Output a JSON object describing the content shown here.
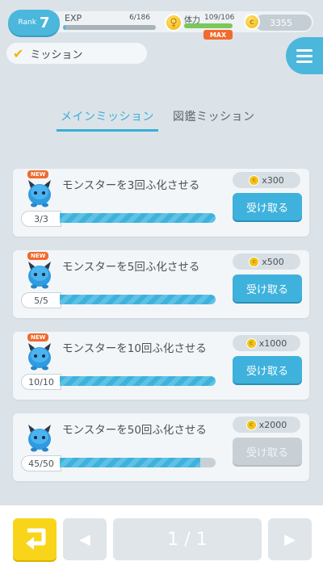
{
  "header": {
    "rank_label": "Rank",
    "rank_value": "7",
    "exp_label": "EXP",
    "exp_value": "6/186",
    "exp_progress": 0.032,
    "stamina_label": "体力",
    "stamina_value": "109/106",
    "stamina_max_badge": "MAX",
    "coins": "3355"
  },
  "mission_toggle": {
    "label": "ミッション"
  },
  "tabs": [
    {
      "label": "メインミッション",
      "active": true
    },
    {
      "label": "図鑑ミッション",
      "active": false
    }
  ],
  "missions": [
    {
      "new_badge": "NEW",
      "title": "モンスターを3回ふ化させる",
      "progress_text": "3/3",
      "progress": 1.0,
      "reward": "x300",
      "claim_label": "受け取る",
      "claimable": true
    },
    {
      "new_badge": "NEW",
      "title": "モンスターを5回ふ化させる",
      "progress_text": "5/5",
      "progress": 1.0,
      "reward": "x500",
      "claim_label": "受け取る",
      "claimable": true
    },
    {
      "new_badge": "NEW",
      "title": "モンスターを10回ふ化させる",
      "progress_text": "10/10",
      "progress": 1.0,
      "reward": "x1000",
      "claim_label": "受け取る",
      "claimable": true
    },
    {
      "new_badge": "",
      "title": "モンスターを50回ふ化させる",
      "progress_text": "45/50",
      "progress": 0.9,
      "reward": "x2000",
      "claim_label": "受け取る",
      "claimable": false
    }
  ],
  "pagination": {
    "page_text": "1 / 1"
  },
  "colors": {
    "accent": "#3eb2dc",
    "new_badge": "#f26a2c",
    "back_button": "#f8d51a",
    "coin": "#f2c218"
  },
  "icons": {
    "menu": "hamburger-icon",
    "check": "checkmark-icon",
    "back": "return-arrow-icon",
    "prev": "triangle-left-icon",
    "next": "triangle-right-icon"
  }
}
